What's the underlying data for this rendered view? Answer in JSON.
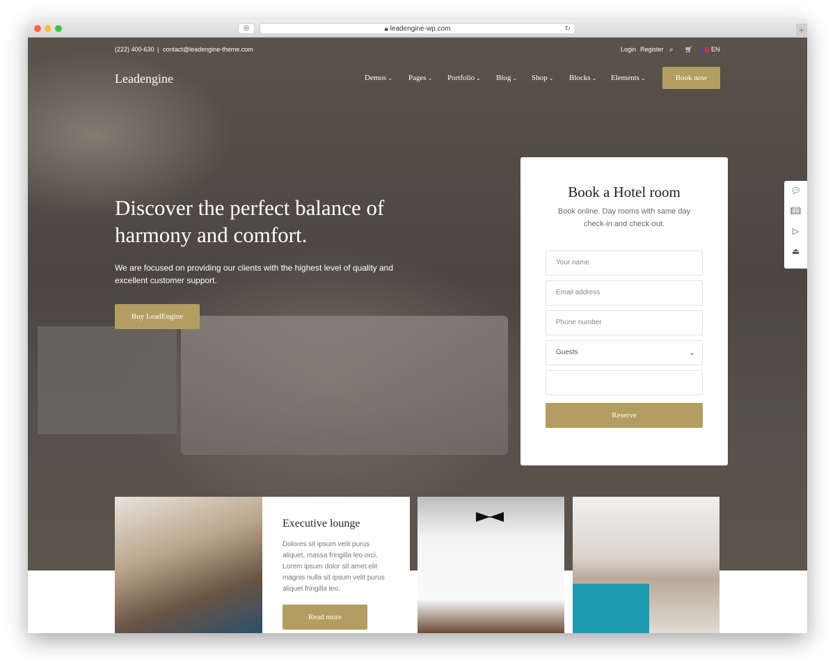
{
  "browser": {
    "url": "leadengine-wp.com"
  },
  "topbar": {
    "phone": "(222) 400-630",
    "separator": "|",
    "email": "contact@leadengine-theme.com",
    "login": "Login",
    "register": "Register",
    "language": "EN"
  },
  "header": {
    "logo": "Leadengine",
    "nav": [
      "Demos",
      "Pages",
      "Portfolio",
      "Blog",
      "Shop",
      "Blocks",
      "Elements"
    ],
    "book_now": "Book now"
  },
  "hero": {
    "title": "Discover the perfect balance of harmony and comfort.",
    "text": "We are focused on providing our clients with the highest level of quality and excellent customer support.",
    "button": "Buy LeadEngine"
  },
  "booking": {
    "title": "Book a Hotel room",
    "subtitle": "Book online. Day rooms with same day check-in and check-out.",
    "name_placeholder": "Your name",
    "email_placeholder": "Email address",
    "phone_placeholder": "Phone number",
    "guests": "Guests",
    "reserve": "Reserve"
  },
  "sidebar_icons": [
    "chat-icon",
    "book-icon",
    "play-icon",
    "bag-icon"
  ],
  "lounge": {
    "title": "Executive lounge",
    "text": "Dolores sit ipsum velit purus aliquet, massa fringilla leo orci. Lorem ipsum dolor sit amet elit magnis nulla sit ipsum velit purus aliquet fringilla leo.",
    "button": "Read more"
  },
  "colors": {
    "accent": "#b39e61"
  }
}
